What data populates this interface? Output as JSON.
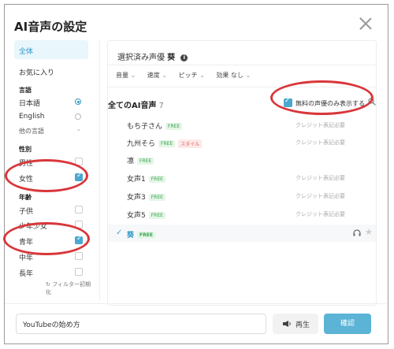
{
  "dialog": {
    "title": "AI音声の設定"
  },
  "sidebar": {
    "all": "全体",
    "favorites": "お気に入り",
    "language_header": "言語",
    "languages": [
      "日本語",
      "English",
      "他の言語"
    ],
    "gender_header": "性別",
    "genders": [
      "男性",
      "女性"
    ],
    "age_header": "年齢",
    "ages": [
      "子供",
      "少年少女",
      "青年",
      "中年",
      "長年"
    ],
    "reset": "フィルター初期化"
  },
  "main": {
    "selected_label": "選択済み声優",
    "selected_name": "葵",
    "params": [
      "音量",
      "速度",
      "ピッチ",
      "効果 なし"
    ],
    "list_title": "全てのAI音声",
    "list_count": "7",
    "free_only_label": "無料の声優のみ表示する",
    "voices": [
      {
        "name": "もち子さん",
        "badges": [
          "FREE"
        ],
        "credit": "クレジット表記必要"
      },
      {
        "name": "九州そら",
        "badges": [
          "FREE",
          "スタイル"
        ],
        "credit": "クレジット表記必要"
      },
      {
        "name": "凛",
        "badges": [
          "FREE"
        ],
        "credit": ""
      },
      {
        "name": "女声1",
        "badges": [
          "FREE"
        ],
        "credit": "クレジット表記必要"
      },
      {
        "name": "女声3",
        "badges": [
          "FREE"
        ],
        "credit": "クレジット表記必要"
      },
      {
        "name": "女声5",
        "badges": [
          "FREE"
        ],
        "credit": "クレジット表記必要"
      },
      {
        "name": "葵",
        "badges": [
          "FREE"
        ],
        "credit": ""
      }
    ]
  },
  "footer": {
    "input_value": "YouTubeの始め方",
    "play_label": "再生",
    "confirm_label": "確認"
  },
  "colors": {
    "accent": "#4aa8cf",
    "annotation": "#d9363a",
    "free_badge": "#3aa352",
    "style_badge": "#e0675f"
  }
}
